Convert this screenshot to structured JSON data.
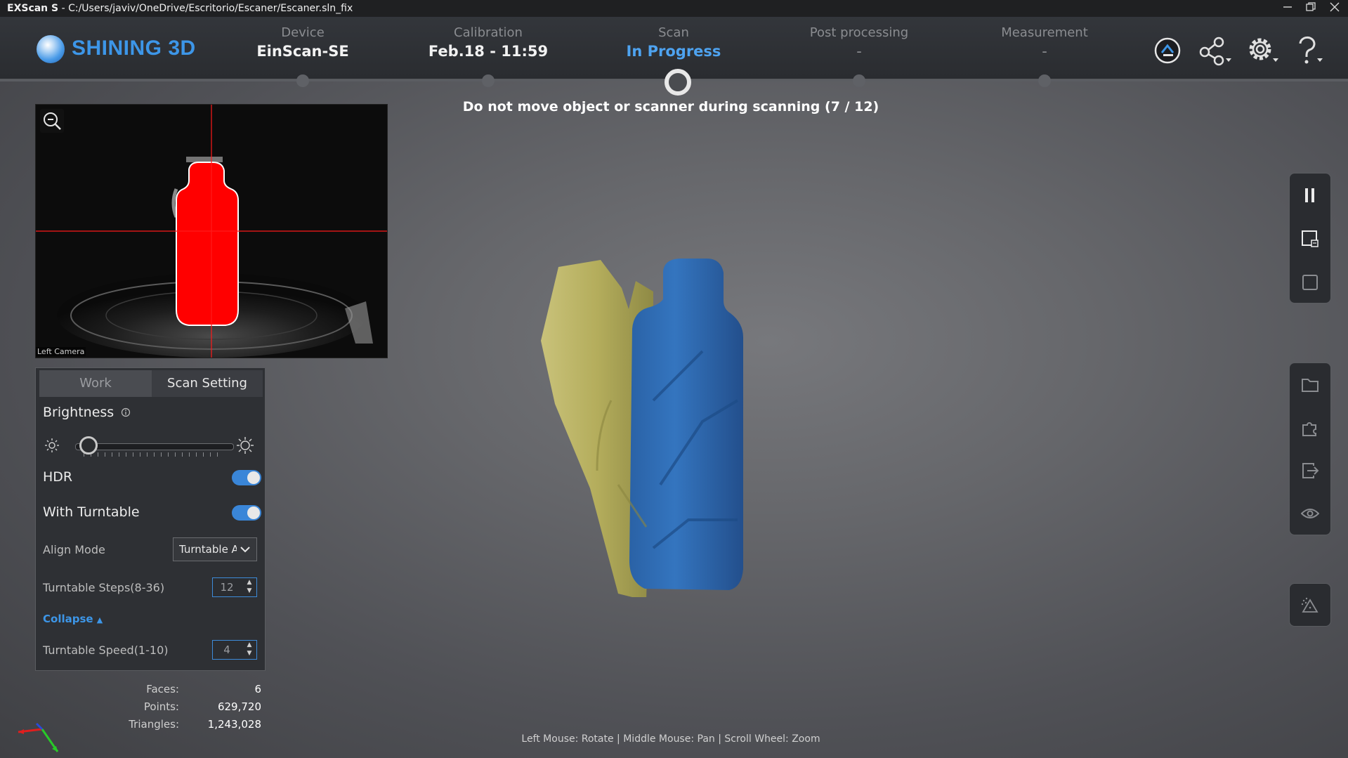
{
  "window": {
    "app_name": "EXScan S",
    "separator": "-",
    "file_path": "C:/Users/javiv/OneDrive/Escritorio/Escaner/Escaner.sln_fix",
    "controls": [
      "minimize-icon",
      "restore-icon",
      "close-icon"
    ]
  },
  "brand": {
    "name": "SHINING 3D",
    "color": "#3d96e8"
  },
  "steps": [
    {
      "label": "Device",
      "value": "EinScan-SE",
      "state": "done"
    },
    {
      "label": "Calibration",
      "value": "Feb.18 - 11:59",
      "state": "done"
    },
    {
      "label": "Scan",
      "value": "In Progress",
      "state": "active"
    },
    {
      "label": "Post processing",
      "value": "-",
      "state": "pending"
    },
    {
      "label": "Measurement",
      "value": "-",
      "state": "pending"
    }
  ],
  "header_icons": [
    "model-icon",
    "share-icon",
    "settings-icon",
    "help-icon"
  ],
  "banner": "Do not move object or scanner during scanning (7 / 12)",
  "camera": {
    "label": "Left Camera",
    "zoom_icon": "zoom-out-icon"
  },
  "panel": {
    "tabs": [
      {
        "label": "Work",
        "selected": false
      },
      {
        "label": "Scan Setting",
        "selected": true
      }
    ],
    "brightness": {
      "label": "Brightness",
      "value": 0.1
    },
    "hdr": {
      "label": "HDR",
      "on": true
    },
    "turntable": {
      "label": "With Turntable",
      "on": true
    },
    "align_mode": {
      "label": "Align Mode",
      "value": "Turntable A"
    },
    "turntable_steps": {
      "label": "Turntable Steps(8-36)",
      "value": "12"
    },
    "collapse": {
      "label": "Collapse"
    },
    "turntable_speed": {
      "label": "Turntable Speed(1-10)",
      "value": "4"
    }
  },
  "stats": [
    {
      "label": "Faces:",
      "value": "6"
    },
    {
      "label": "Points:",
      "value": "629,720"
    },
    {
      "label": "Triangles:",
      "value": "1,243,028"
    }
  ],
  "right_toolbar": [
    [
      "pause-icon",
      "delete-frame-icon",
      "frame-icon"
    ],
    [
      "folder-icon",
      "plugin-icon",
      "export-icon",
      "visibility-icon"
    ],
    [
      "point-cloud-icon"
    ]
  ],
  "hint": "Left Mouse: Rotate | Middle Mouse: Pan | Scroll Wheel: Zoom",
  "colors": {
    "accent": "#3d96e8",
    "scan_blue": "#2f6db3",
    "scan_yellow": "#b3ad58",
    "mask_red": "#ff0000"
  }
}
